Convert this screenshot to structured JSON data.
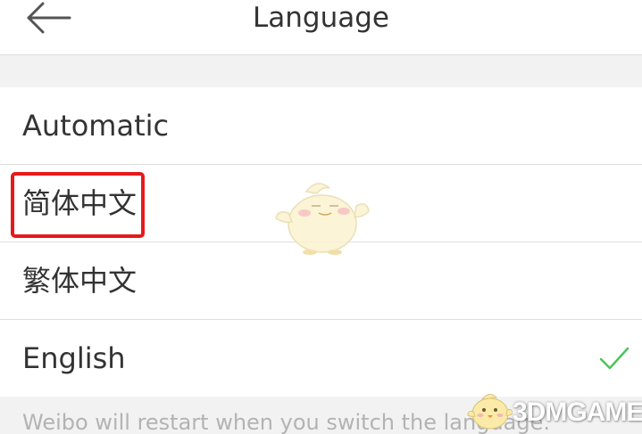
{
  "header": {
    "title": "Language",
    "back_icon": "arrow-left-icon"
  },
  "options": [
    {
      "label": "Automatic",
      "selected": false,
      "highlighted": false
    },
    {
      "label": "简体中文",
      "selected": false,
      "highlighted": true
    },
    {
      "label": "繁体中文",
      "selected": false,
      "highlighted": false
    },
    {
      "label": "English",
      "selected": true,
      "highlighted": false
    }
  ],
  "footer": {
    "note": "Weibo will restart when you switch the language."
  },
  "watermark": {
    "brand": "3DMGAME",
    "mascot_icon": "chick-mascot-icon"
  },
  "colors": {
    "accent_check": "#4cc45c",
    "highlight_border": "#e8191b",
    "background": "#f2f2f2"
  }
}
